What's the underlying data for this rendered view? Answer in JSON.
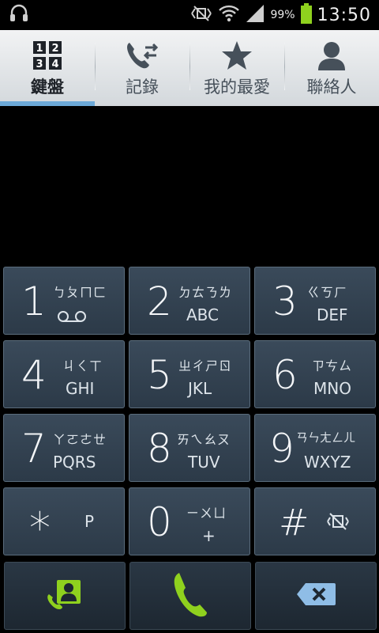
{
  "status_bar": {
    "battery_percent": "99%",
    "time": "13:50",
    "icons": [
      "headset-icon",
      "mute-icon",
      "wifi-icon",
      "signal-icon",
      "battery-icon"
    ]
  },
  "tabs": [
    {
      "label": "鍵盤",
      "icon": "dialpad-icon",
      "active": true
    },
    {
      "label": "記錄",
      "icon": "call-log-icon",
      "active": false
    },
    {
      "label": "我的最愛",
      "icon": "star-icon",
      "active": false
    },
    {
      "label": "聯絡人",
      "icon": "contact-icon",
      "active": false
    }
  ],
  "dialpad_icon_digits": [
    "1",
    "2",
    "3",
    "4"
  ],
  "keypad": {
    "keys": [
      {
        "digit": "1",
        "zhuyin": "ㄅㄆㄇㄈ",
        "latin": "",
        "extra_icon": "voicemail-icon"
      },
      {
        "digit": "2",
        "zhuyin": "ㄉㄊㄋㄌ",
        "latin": "ABC"
      },
      {
        "digit": "3",
        "zhuyin": "ㄍㄎㄏ",
        "latin": "DEF"
      },
      {
        "digit": "4",
        "zhuyin": "ㄐㄑㄒ",
        "latin": "GHI"
      },
      {
        "digit": "5",
        "zhuyin": "ㄓㄔㄕㄖ",
        "latin": "JKL"
      },
      {
        "digit": "6",
        "zhuyin": "ㄗㄘㄙ",
        "latin": "MNO"
      },
      {
        "digit": "7",
        "zhuyin": "ㄚㄛㄜㄝ",
        "latin": "PQRS"
      },
      {
        "digit": "8",
        "zhuyin": "ㄞㄟㄠㄡ",
        "latin": "TUV"
      },
      {
        "digit": "9",
        "zhuyin": "ㄢㄣㄤㄥㄦ",
        "latin": "WXYZ"
      },
      {
        "digit": "*",
        "zhuyin": "",
        "latin": "P"
      },
      {
        "digit": "0",
        "zhuyin": "ㄧㄨㄩ",
        "latin": "+"
      },
      {
        "digit": "#",
        "zhuyin": "",
        "latin": "",
        "extra_icon": "vibrate-mute-icon"
      }
    ]
  },
  "actions": [
    {
      "name": "add-to-contacts-button",
      "icon": "add-contact-icon"
    },
    {
      "name": "call-button",
      "icon": "phone-icon"
    },
    {
      "name": "delete-button",
      "icon": "backspace-icon"
    }
  ],
  "colors": {
    "accent_green": "#8fd11e",
    "tab_indicator": "#6ca9d8",
    "key_background": "#334352"
  }
}
